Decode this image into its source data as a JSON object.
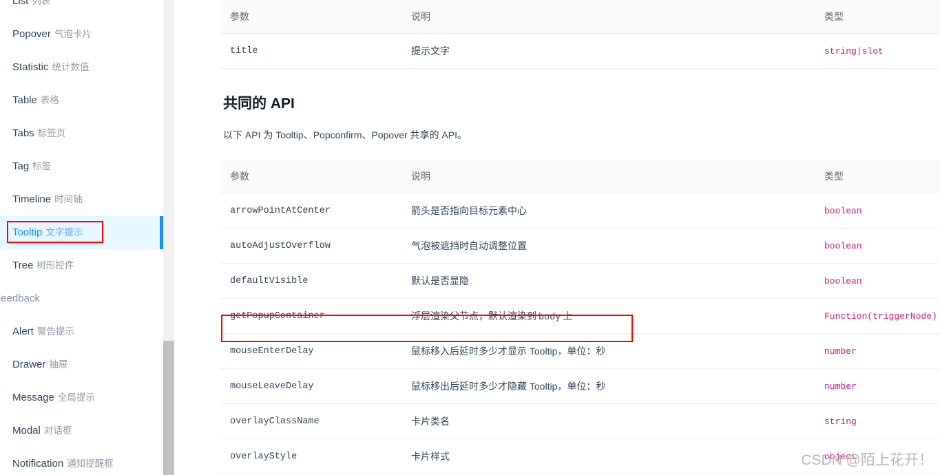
{
  "sidebar": {
    "items": [
      {
        "en": "List",
        "cn": "列表",
        "active": false,
        "group": false
      },
      {
        "en": "Popover",
        "cn": "气泡卡片",
        "active": false,
        "group": false
      },
      {
        "en": "Statistic",
        "cn": "统计数值",
        "active": false,
        "group": false
      },
      {
        "en": "Table",
        "cn": "表格",
        "active": false,
        "group": false
      },
      {
        "en": "Tabs",
        "cn": "标签页",
        "active": false,
        "group": false
      },
      {
        "en": "Tag",
        "cn": "标签",
        "active": false,
        "group": false
      },
      {
        "en": "Timeline",
        "cn": "时间轴",
        "active": false,
        "group": false
      },
      {
        "en": "Tooltip",
        "cn": "文字提示",
        "active": true,
        "group": false
      },
      {
        "en": "Tree",
        "cn": "树形控件",
        "active": false,
        "group": false
      },
      {
        "en": "Feedback",
        "cn": "",
        "active": false,
        "group": true
      },
      {
        "en": "Alert",
        "cn": "警告提示",
        "active": false,
        "group": false
      },
      {
        "en": "Drawer",
        "cn": "抽屉",
        "active": false,
        "group": false
      },
      {
        "en": "Message",
        "cn": "全局提示",
        "active": false,
        "group": false
      },
      {
        "en": "Modal",
        "cn": "对话框",
        "active": false,
        "group": false
      },
      {
        "en": "Notification",
        "cn": "通知提醒框",
        "active": false,
        "group": false
      }
    ],
    "active_label": "Tooltip 文字提示"
  },
  "main": {
    "table_top": {
      "headers": [
        "参数",
        "说明",
        "类型"
      ],
      "rows": [
        {
          "param": "title",
          "desc": "提示文字",
          "desc_code": "",
          "desc_tail": "",
          "type": "string|slot"
        }
      ]
    },
    "section": {
      "title": "共同的 API",
      "description": "以下 API 为 Tooltip、Popconfirm、Popover 共享的 API。"
    },
    "table_common": {
      "headers": [
        "参数",
        "说明",
        "类型"
      ],
      "rows": [
        {
          "param": "arrowPointAtCenter",
          "desc": "箭头是否指向目标元素中心",
          "desc_code": "",
          "desc_tail": "",
          "type": "boolean"
        },
        {
          "param": "autoAdjustOverflow",
          "desc": "气泡被遮挡时自动调整位置",
          "desc_code": "",
          "desc_tail": "",
          "type": "boolean"
        },
        {
          "param": "defaultVisible",
          "desc": "默认是否显隐",
          "desc_code": "",
          "desc_tail": "",
          "type": "boolean"
        },
        {
          "param": "getPopupContainer",
          "desc": "浮层渲染父节点，默认渲染到",
          "desc_code": "body",
          "desc_tail": "上",
          "type": "Function(triggerNode)"
        },
        {
          "param": "mouseEnterDelay",
          "desc": "鼠标移入后延时多少才显示 Tooltip，单位：秒",
          "desc_code": "",
          "desc_tail": "",
          "type": "number"
        },
        {
          "param": "mouseLeaveDelay",
          "desc": "鼠标移出后延时多少才隐藏 Tooltip，单位：秒",
          "desc_code": "",
          "desc_tail": "",
          "type": "number"
        },
        {
          "param": "overlayClassName",
          "desc": "卡片类名",
          "desc_code": "",
          "desc_tail": "",
          "type": "string"
        },
        {
          "param": "overlayStyle",
          "desc": "卡片样式",
          "desc_code": "",
          "desc_tail": "",
          "type": "object"
        }
      ]
    }
  },
  "watermark": {
    "text": "CSDN @陌上花开！"
  },
  "colors": {
    "accent": "#1890ff",
    "active_bg": "#e6f7ff",
    "annotation": "#ff0000",
    "type_text": "#c41d7f",
    "param_text": "#314659",
    "header_bg": "#fafafa",
    "border": "#ebedf0"
  }
}
